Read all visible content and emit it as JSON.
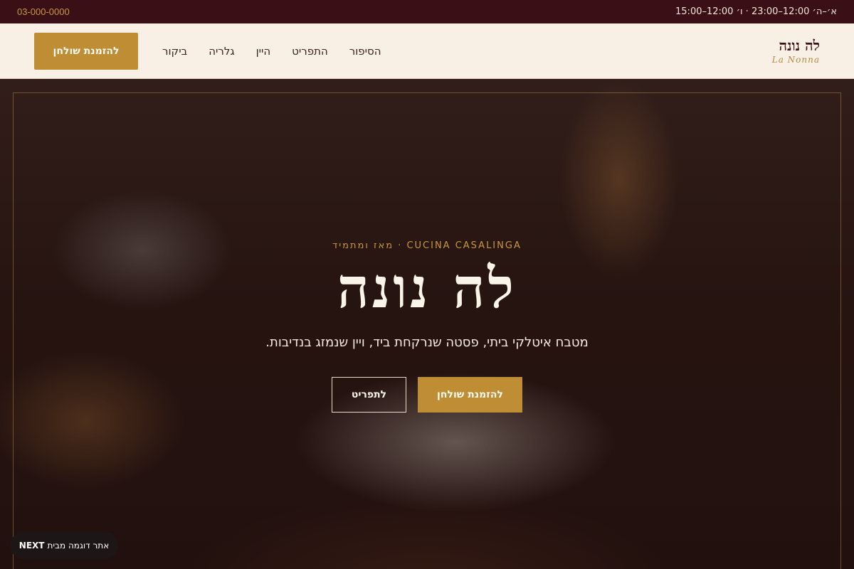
{
  "topbar": {
    "phone": "03-000-0000",
    "hours": "א׳–ה׳ 12:00–23:00 · ו׳ 12:00–15:00"
  },
  "header": {
    "reserve_label": "להזמנת שולחן",
    "nav": [
      {
        "label": "הסיפור"
      },
      {
        "label": "התפריט"
      },
      {
        "label": "היין"
      },
      {
        "label": "גלריה"
      },
      {
        "label": "ביקור"
      }
    ],
    "logo_hebrew": "לה נונה",
    "logo_latin": "La Nonna"
  },
  "hero": {
    "kicker": "CUCINA CASALINGA · מאז ומתמיד",
    "title": "לה נונה",
    "tagline": "מטבח איטלקי ביתי, פסטה שנרקחת ביד, ויין שנמזג בנדיבות.",
    "primary_button": "להזמנת שולחן",
    "secondary_button": "לתפריט"
  },
  "badge": {
    "prefix": "אתר דוגמה מבית",
    "brand": "NEXT"
  },
  "colors": {
    "topbar_bg": "#3a1016",
    "accent_gold": "#bf8d34",
    "header_bg": "#f8f0e5"
  }
}
